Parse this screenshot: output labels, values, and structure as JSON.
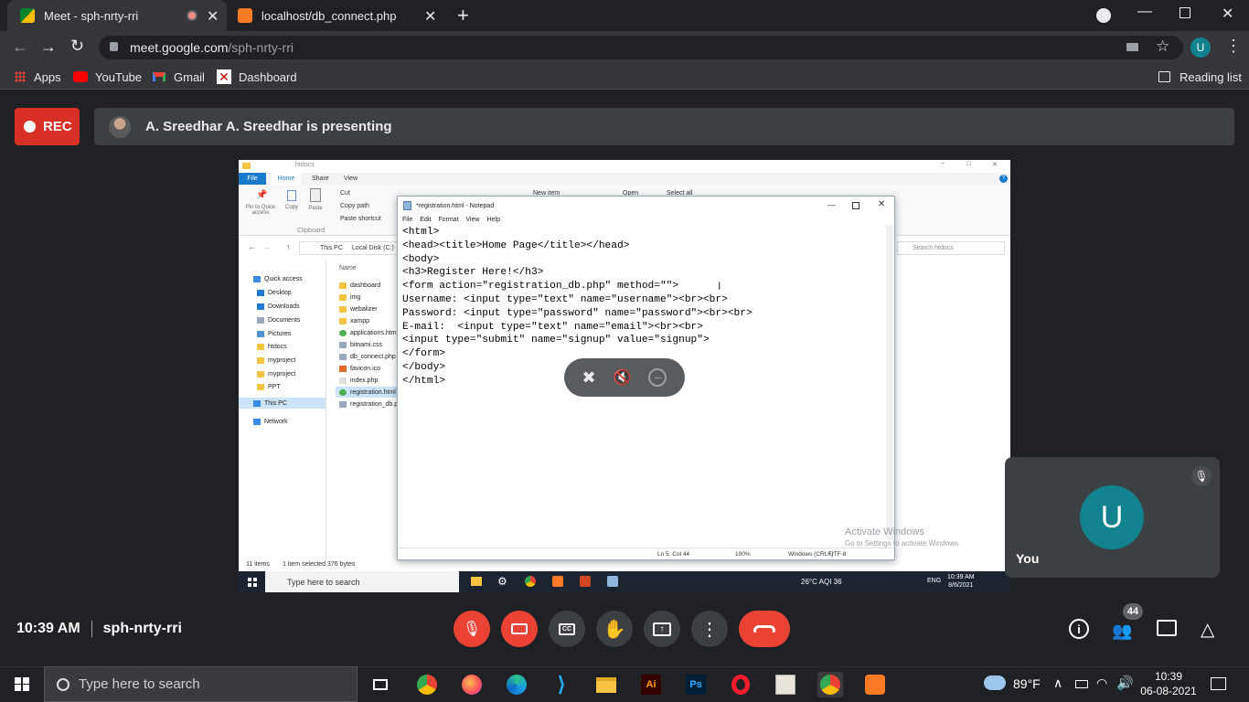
{
  "browser": {
    "tabs": [
      {
        "title": "Meet - sph-nrty-rri",
        "active": true
      },
      {
        "title": "localhost/db_connect.php",
        "active": false
      }
    ],
    "url_host": "meet.google.com",
    "url_path": "/sph-nrty-rri",
    "profile_initial": "U",
    "bookmarks": [
      "Apps",
      "YouTube",
      "Gmail",
      "Dashboard"
    ],
    "reading_list": "Reading list"
  },
  "meet": {
    "rec_label": "REC",
    "presenting": "A. Sreedhar A. Sreedhar is presenting",
    "self_label": "You",
    "self_initial": "U",
    "time": "10:39 AM",
    "meeting_code": "sph-nrty-rri",
    "participants_count": "44",
    "activate_windows": "Activate Windows",
    "activate_windows_sub": "Go to Settings to activate Windows."
  },
  "shared_screen": {
    "explorer": {
      "title": "htdocs",
      "ribbon_tabs": [
        "File",
        "Home",
        "Share",
        "View"
      ],
      "ribbon_buttons": [
        "Pin to Quick access",
        "Copy",
        "Paste",
        "Cut",
        "Copy path",
        "Paste shortcut"
      ],
      "ribbon_group": "Clipboard",
      "breadcrumb": [
        "This PC",
        "Local Disk (C:)"
      ],
      "search_placeholder": "Search htdocs",
      "column_name": "Name",
      "nav_items": [
        "Quick access",
        "Desktop",
        "Downloads",
        "Documents",
        "Pictures",
        "htdocs",
        "myproject",
        "myproject",
        "PPT",
        "This PC",
        "Network"
      ],
      "files": [
        "dashboard",
        "img",
        "webalizer",
        "xampp",
        "applications.html",
        "bitnami.css",
        "db_connect.php",
        "favicon.ico",
        "index.php",
        "registration.html",
        "registration_db.php"
      ],
      "status_items": "11 items",
      "status_selected": "1 item selected  376 bytes",
      "ribbon_extra": [
        "New item",
        "Open",
        "Select all"
      ]
    },
    "notepad": {
      "title": "*registration.html - Notepad",
      "menu": [
        "File",
        "Edit",
        "Format",
        "View",
        "Help"
      ],
      "lines": [
        "<html>",
        "<head><title>Home Page</title></head>",
        "<body>",
        "<h3>Register Here!</h3>",
        "<form action=\"registration_db.php\" method=\"\">",
        "Username: <input type=\"text\" name=\"username\"><br><br>",
        "Password: <input type=\"password\" name=\"password\"><br><br>",
        "E-mail:  <input type=\"text\" name=\"email\"><br><br>",
        "<input type=\"submit\" name=\"signup\" value=\"signup\">",
        "</form>",
        "</body>",
        "</html>"
      ],
      "status_position": "Ln 5, Col 44",
      "status_zoom": "100%",
      "status_eol": "Windows (CRLF)",
      "status_encoding": "UTF-8"
    },
    "taskbar": {
      "search": "Type here to search",
      "weather": "26°C  AQI 36",
      "lang": "ENG",
      "time": "10:39 AM",
      "date": "8/6/2021"
    }
  },
  "taskbar": {
    "search_placeholder": "Type here to search",
    "weather": "89°F",
    "time": "10:39",
    "date": "06-08-2021"
  },
  "colors": {
    "rec_red": "#d93025",
    "end_call_red": "#ea4335",
    "avatar_teal": "#12838e",
    "meet_bg": "#202124"
  }
}
